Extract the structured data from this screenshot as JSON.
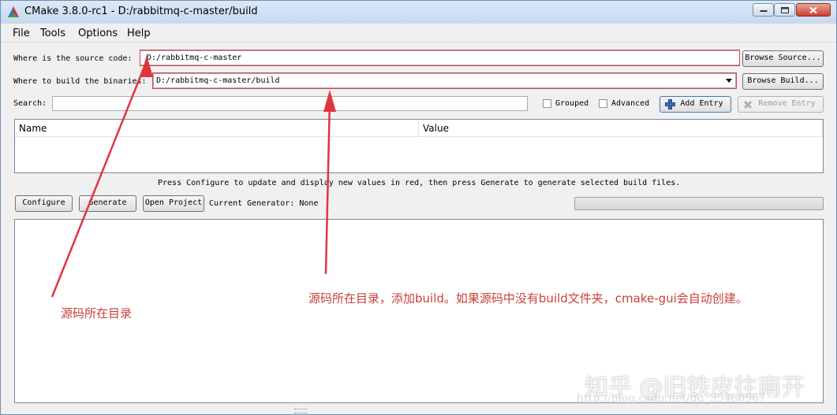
{
  "window": {
    "title": "CMake 3.8.0-rc1 - D:/rabbitmq-c-master/build"
  },
  "menu": [
    "File",
    "Tools",
    "Options",
    "Help"
  ],
  "source": {
    "label": "Where is the source code:",
    "value": "D:/rabbitmq-c-master",
    "browse_label": "Browse Source..."
  },
  "build": {
    "label": "Where to build the binaries:",
    "value": "D:/rabbitmq-c-master/build",
    "browse_label": "Browse Build..."
  },
  "search": {
    "label": "Search:",
    "value": "",
    "grouped_label": "Grouped",
    "grouped_checked": false,
    "advanced_label": "Advanced",
    "advanced_checked": false,
    "add_entry_label": "Add Entry",
    "remove_entry_label": "Remove Entry"
  },
  "table": {
    "columns": [
      "Name",
      "Value"
    ],
    "rows": []
  },
  "hint": "Press Configure to update and display new values in red, then press Generate to generate selected build files.",
  "actions": {
    "configure_label": "Configure",
    "generate_label": "Generate",
    "open_project_label": "Open Project",
    "generator_text": "Current Generator: None"
  },
  "progress": 0,
  "annotations": {
    "source_note": "源码所在目录",
    "build_note": "源码所在目录，添加build。如果源码中没有build文件夹，cmake-gui会自动创建。",
    "color": "#d9434b"
  },
  "watermark": {
    "text": "知乎 @旧铁皮往南开",
    "url": "http://blog.csdn.net/qq_35488967"
  }
}
